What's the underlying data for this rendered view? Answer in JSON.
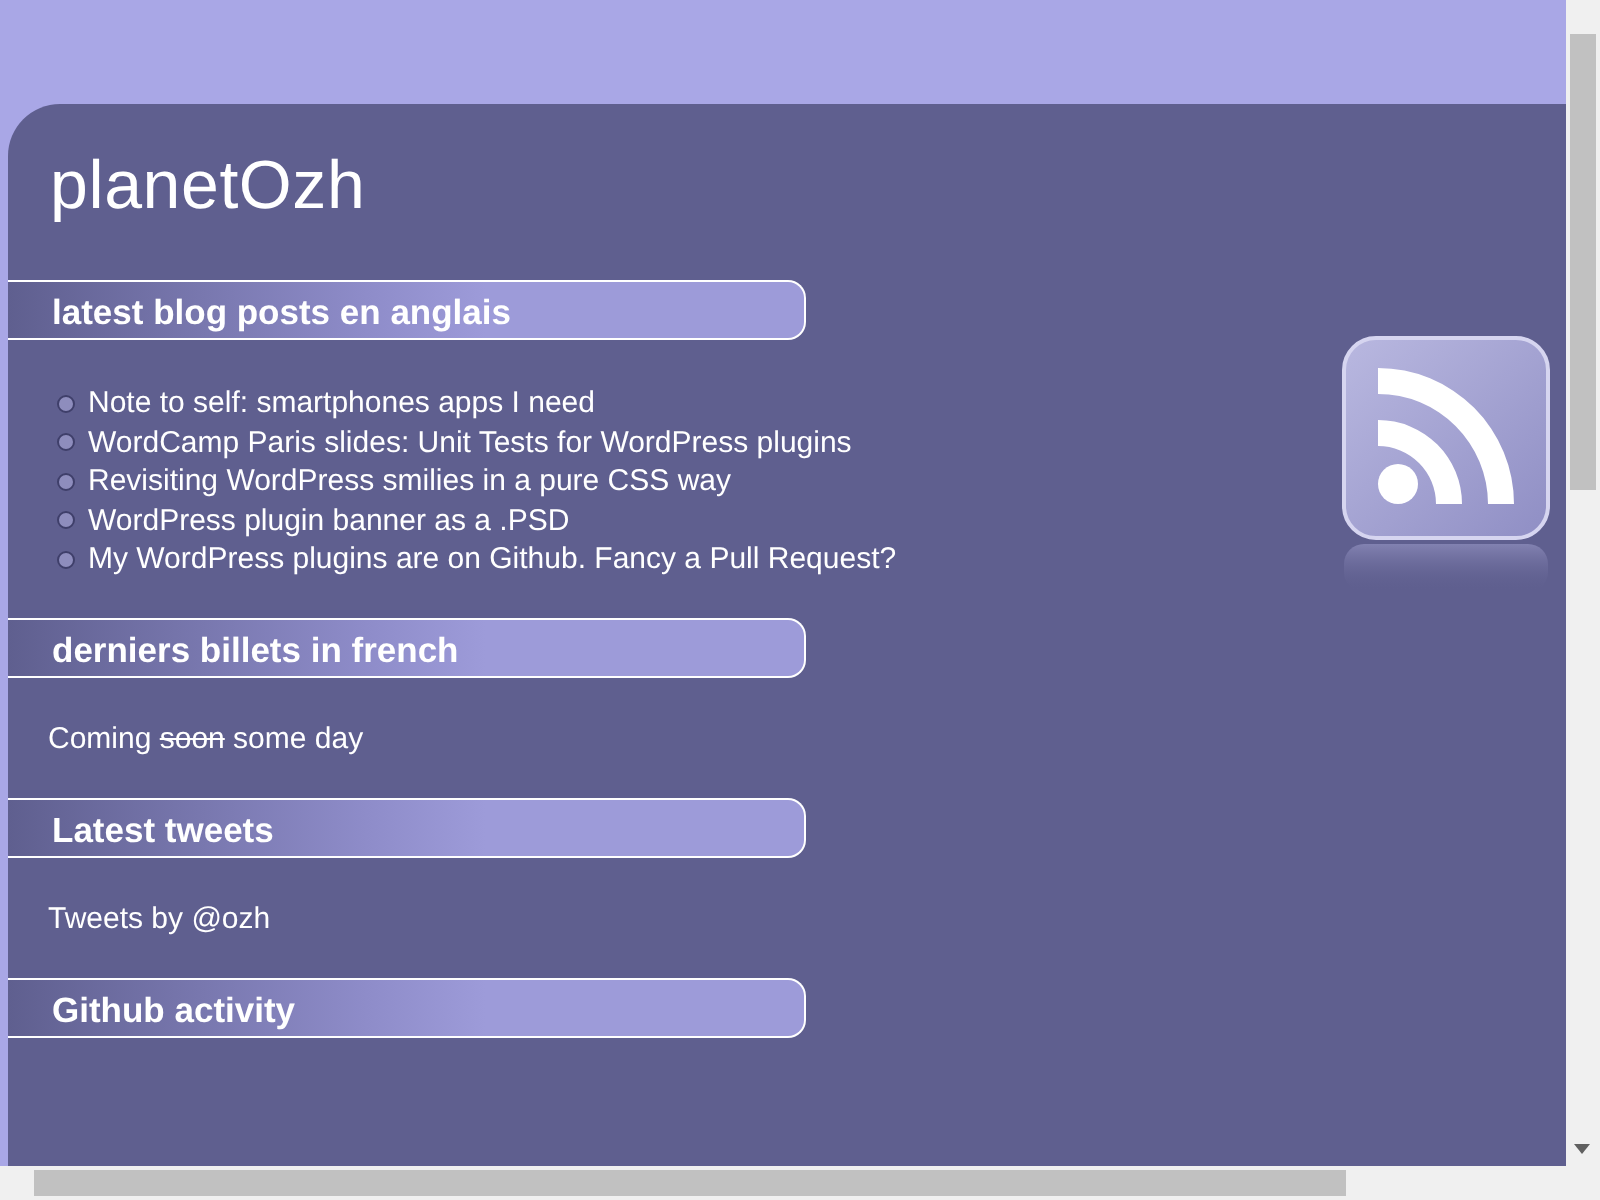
{
  "site_title": "planetOzh",
  "sections": [
    {
      "title": "latest blog posts en anglais",
      "kind": "list",
      "items": [
        "Note to self: smartphones apps I need",
        "WordCamp Paris slides: Unit Tests for WordPress plugins",
        "Revisiting WordPress smilies in a pure CSS way",
        "WordPress plugin banner as a .PSD",
        "My WordPress plugins are on Github. Fancy a Pull Request?"
      ]
    },
    {
      "title": "derniers billets in french",
      "kind": "text",
      "parts": [
        {
          "text": "Coming ",
          "struck": false
        },
        {
          "text": "soon",
          "struck": true
        },
        {
          "text": " some day",
          "struck": false
        }
      ]
    },
    {
      "title": "Latest tweets",
      "kind": "text",
      "parts": [
        {
          "text": "Tweets by @ozh",
          "struck": false
        }
      ]
    },
    {
      "title": "Github activity",
      "kind": "empty"
    }
  ]
}
